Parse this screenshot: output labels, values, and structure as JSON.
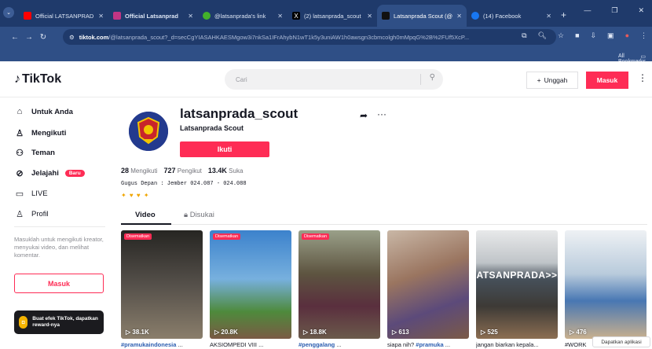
{
  "browser": {
    "tabs": [
      {
        "title": "Official LATSANPRAD",
        "favicon_color": "#ff0000",
        "active": false
      },
      {
        "title": "Official Latsanprad",
        "favicon_color": "#c13584",
        "active": false
      },
      {
        "title": "@latsanprada's link",
        "favicon_color": "#43b02a",
        "active": false
      },
      {
        "title": "(2) latsanprada_scout",
        "favicon_color": "#000000",
        "active": false
      },
      {
        "title": "Latsanprada Scout (@",
        "favicon_color": "#111111",
        "active": true
      },
      {
        "title": "(14) Facebook",
        "favicon_color": "#1877f2",
        "active": false
      }
    ],
    "url_host": "tiktok.com",
    "url_path": "/@latsanprada_scout?_d=secCgYIASAHKAESMgow3i7nkSa1IFrAhybN1wT1k5y3uniAW1h0awsgn3cbmcolgh0mMpqG%2B%2FUf5XcP...",
    "bookmarks_label": "All Bookmarks"
  },
  "header": {
    "logo_text": "TikTok",
    "search_placeholder": "Cari",
    "upload_label": "Unggah",
    "login_label": "Masuk"
  },
  "sidebar": {
    "items": [
      {
        "label": "Untuk Anda",
        "icon": "home-icon"
      },
      {
        "label": "Mengikuti",
        "icon": "following-icon"
      },
      {
        "label": "Teman",
        "icon": "friends-icon"
      },
      {
        "label": "Jelajahi",
        "icon": "explore-icon",
        "badge": "Baru"
      },
      {
        "label": "LIVE",
        "icon": "live-icon"
      },
      {
        "label": "Profil",
        "icon": "profile-icon"
      }
    ],
    "login_prompt": "Masuklah untuk mengikuti kreator, menyukai video, dan melihat komentar.",
    "login_button": "Masuk",
    "promo_text": "Buat efek TikTok, dapatkan reward-nya"
  },
  "profile": {
    "username": "latsanprada_scout",
    "nickname": "Latsanprada Scout",
    "follow_label": "Ikuti",
    "following_count": "28",
    "following_label": "Mengikuti",
    "followers_count": "727",
    "followers_label": "Pengikut",
    "likes_count": "13.4K",
    "likes_label": "Suka",
    "bio_line1": "Gugus Depan : Jember 024.087 - 024.088",
    "bio_line2": "✦ ♥ ♥ ✦"
  },
  "content_tabs": {
    "videos": "Video",
    "liked": "Disukai"
  },
  "videos": [
    {
      "views": "38.1K",
      "pinned": "Disematkan",
      "caption_tag": "#pramukaindonesia",
      "caption_rest": " ...",
      "bg": "#3f3b34"
    },
    {
      "views": "20.8K",
      "pinned": "Disematkan",
      "caption_tag": "",
      "caption_rest": "AKSIOMPEDI VIII ...",
      "bg": "#5d8fb8"
    },
    {
      "views": "18.8K",
      "pinned": "Disematkan",
      "caption_tag": "#penggalang",
      "caption_rest": " ...",
      "bg": "#6a5f49"
    },
    {
      "views": "613",
      "pinned": "",
      "caption_tag": "",
      "caption_rest": "siapa nih? ",
      "caption_tag2": "#pramuka",
      "caption_rest2": " ...",
      "bg": "#8a6b58"
    },
    {
      "views": "525",
      "pinned": "",
      "caption_tag": "",
      "caption_rest": "jangan biarkan kepala...",
      "bg": "#5c6670",
      "overlay": "ATSANPRADA>>"
    },
    {
      "views": "476",
      "pinned": "",
      "caption_tag": "",
      "caption_rest": "#WORK",
      "bg": "#8aa7c4"
    }
  ],
  "toast": "Dapatkan aplikasi"
}
